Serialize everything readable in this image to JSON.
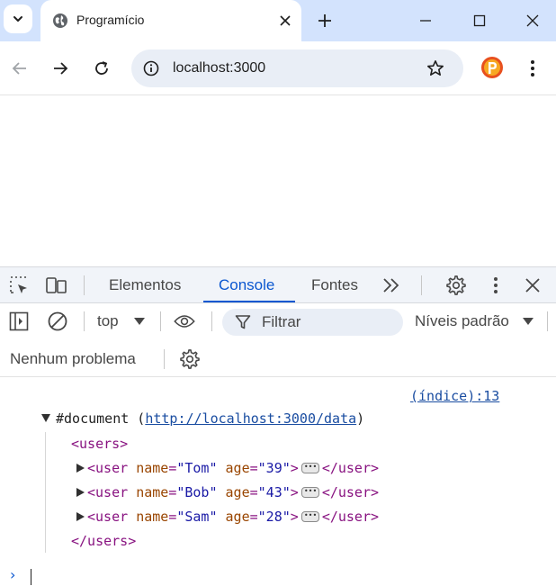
{
  "browser": {
    "tab_title": "Programício",
    "url": "localhost:3000",
    "colors": {
      "tabstrip": "#d3e3fd",
      "accent": "#0b57d0"
    }
  },
  "devtools": {
    "tabs": [
      {
        "label": "Elementos",
        "active": false
      },
      {
        "label": "Console",
        "active": true
      },
      {
        "label": "Fontes",
        "active": false
      }
    ],
    "context": "top",
    "filter_placeholder": "Filtrar",
    "levels": "Níveis padrão",
    "issues": "Nenhum problema"
  },
  "console": {
    "source_link": "(índice):13",
    "document_label": "#document",
    "document_url": "http://localhost:3000/data",
    "users_open": "<users>",
    "users_close": "</users>",
    "user_tag_open": "<user",
    "user_tag_close": "</user>",
    "attr_name": "name",
    "attr_age": "age",
    "users": [
      {
        "name": "\"Tom\"",
        "age": "\"39\""
      },
      {
        "name": "\"Bob\"",
        "age": "\"43\""
      },
      {
        "name": "\"Sam\"",
        "age": "\"28\""
      }
    ],
    "prompt": "›"
  }
}
